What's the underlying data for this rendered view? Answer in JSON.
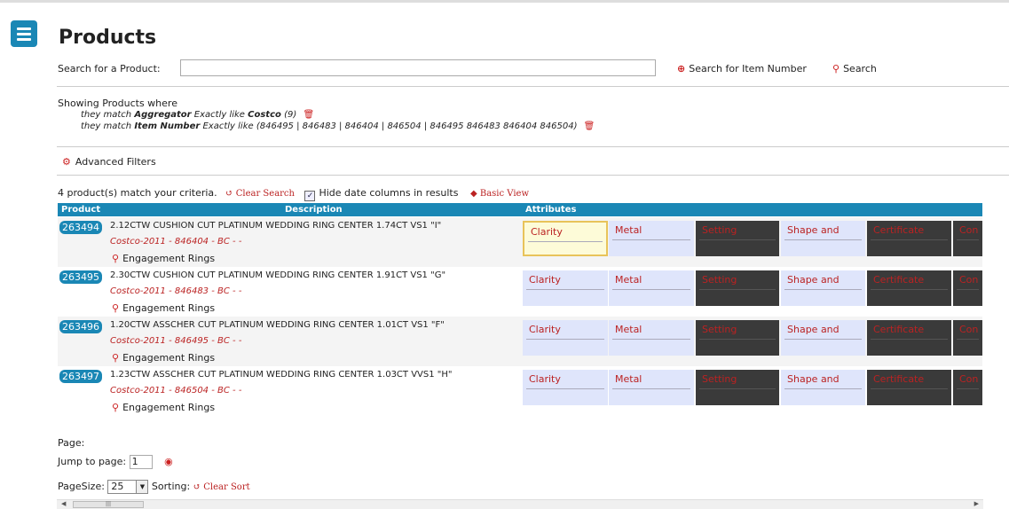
{
  "page": {
    "title": "Products"
  },
  "search": {
    "label": "Search for a Product:",
    "value": "",
    "item_number_label": "Search for Item Number",
    "search_label": "Search"
  },
  "filters": {
    "heading": "Showing Products where",
    "items": [
      {
        "prefix": "they match",
        "field": "Aggregator",
        "op": "Exactly like",
        "value": "Costco",
        "count": "(9)"
      },
      {
        "prefix": "they match",
        "field": "Item Number",
        "op": "Exactly like",
        "value": "(846495 | 846483 | 846404 | 846504 | 846495 846483 846404 846504)",
        "count": ""
      }
    ]
  },
  "advanced": {
    "label": "Advanced Filters"
  },
  "results": {
    "count_text": "4 product(s) match your criteria.",
    "clear_search": "Clear Search",
    "hide_dates_label": "Hide date columns in results",
    "hide_dates_checked": true,
    "basic_view": "Basic View"
  },
  "table": {
    "headers": {
      "product": "Product",
      "description": "Description",
      "attributes": "Attributes"
    },
    "attribute_labels": [
      "Clarity",
      "Metal",
      "Setting",
      "Shape and",
      "Certificate",
      "Con"
    ],
    "rows": [
      {
        "id": "263494",
        "desc": "2.12CTW CUSHION CUT PLATINUM WEDDING RING CENTER 1.74CT VS1 \"I\"",
        "sub": "Costco-2011 - 846404 - BC - -",
        "category": "Engagement Rings"
      },
      {
        "id": "263495",
        "desc": "2.30CTW CUSHION CUT PLATINUM WEDDING RING CENTER 1.91CT VS1 \"G\"",
        "sub": "Costco-2011 - 846483 - BC - -",
        "category": "Engagement Rings"
      },
      {
        "id": "263496",
        "desc": "1.20CTW ASSCHER CUT PLATINUM WEDDING RING CENTER 1.01CT VS1 \"F\"",
        "sub": "Costco-2011 - 846495 - BC - -",
        "category": "Engagement Rings"
      },
      {
        "id": "263497",
        "desc": "1.23CTW ASSCHER CUT PLATINUM WEDDING RING CENTER 1.03CT VVS1 \"H\"",
        "sub": "Costco-2011 - 846504 - BC - -",
        "category": "Engagement Rings"
      }
    ]
  },
  "pagination": {
    "page_label": "Page:",
    "jump_label": "Jump to page:",
    "jump_value": "1",
    "pagesize_label": "PageSize:",
    "pagesize_value": "25",
    "sorting_label": "Sorting:",
    "clear_sort": "Clear Sort"
  },
  "icons": {
    "menu": "hamburger-icon",
    "search": "magnifier-icon",
    "trash": "trash-icon",
    "gear": "gears-icon",
    "undo": "undo-icon",
    "tag": "tag-icon",
    "eye": "eye-icon"
  },
  "colors": {
    "accent": "#1a87b5",
    "link": "#bb2222",
    "attr_light": "#dfe5fb",
    "attr_dark": "#3a3a3a",
    "selected": "#fdfbd8"
  }
}
